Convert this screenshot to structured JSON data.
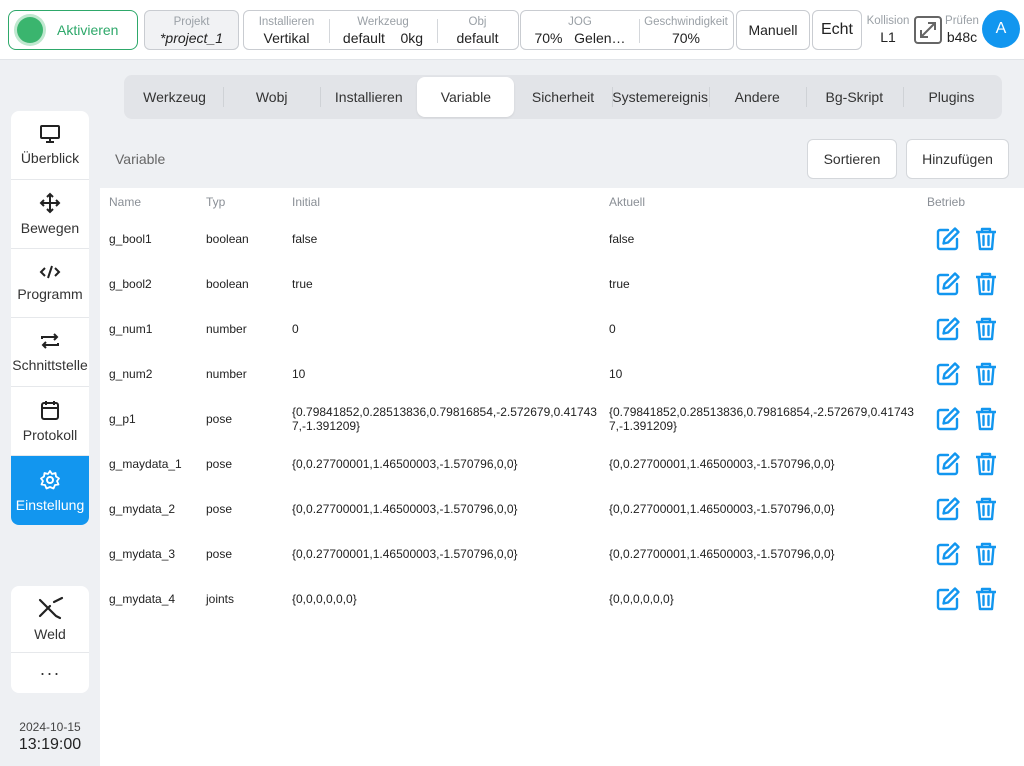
{
  "topbar": {
    "activate_label": "Aktivieren",
    "project": {
      "label": "Projekt",
      "value": "*project_1"
    },
    "install_group": [
      {
        "label": "Installieren",
        "value": "Vertikal"
      },
      {
        "label": "Werkzeug",
        "value": "default    0kg"
      },
      {
        "label": "Obj",
        "value": "default"
      }
    ],
    "jog_group": [
      {
        "label": "JOG",
        "value": "70%   Gelen…"
      },
      {
        "label": "Geschwindigkeit",
        "value": "70%"
      }
    ],
    "mode_label": "Manuell",
    "real_label": "Echt",
    "collision": {
      "label": "Kollision",
      "value": "L1"
    },
    "check": {
      "label": "Prüfen",
      "value": "b48c"
    },
    "avatar_letter": "A",
    "icons": {
      "expand": "expand-icon"
    }
  },
  "sidebar": {
    "items": [
      {
        "label": "Überblick",
        "icon": "monitor-icon"
      },
      {
        "label": "Bewegen",
        "icon": "move-icon"
      },
      {
        "label": "Programm",
        "icon": "code-icon"
      },
      {
        "label": "Schnittstelle",
        "icon": "swap-icon"
      },
      {
        "label": "Protokoll",
        "icon": "calendar-icon"
      },
      {
        "label": "Einstellung",
        "icon": "gear-icon",
        "active": true
      }
    ],
    "extra": [
      {
        "label": "Weld",
        "icon": "weld-icon"
      },
      {
        "label": "···",
        "icon": "more-icon"
      }
    ],
    "date": "2024-10-15",
    "time": "13:19:00"
  },
  "tabs": [
    {
      "label": "Werkzeug"
    },
    {
      "label": "Wobj"
    },
    {
      "label": "Installieren"
    },
    {
      "label": "Variable",
      "active": true
    },
    {
      "label": "Sicherheit"
    },
    {
      "label": "Systemereignis"
    },
    {
      "label": "Andere"
    },
    {
      "label": "Bg-Skript"
    },
    {
      "label": "Plugins"
    }
  ],
  "variable_panel": {
    "title": "Variable",
    "sort_label": "Sortieren",
    "add_label": "Hinzufügen",
    "columns": {
      "name": "Name",
      "type": "Typ",
      "initial": "Initial",
      "current": "Aktuell",
      "ops": "Betrieb"
    },
    "rows": [
      {
        "name": "g_bool1",
        "type": "boolean",
        "initial": "false",
        "current": "false"
      },
      {
        "name": "g_bool2",
        "type": "boolean",
        "initial": "true",
        "current": "true"
      },
      {
        "name": "g_num1",
        "type": "number",
        "initial": "0",
        "current": "0"
      },
      {
        "name": "g_num2",
        "type": "number",
        "initial": "10",
        "current": "10"
      },
      {
        "name": "g_p1",
        "type": "pose",
        "initial": "{0.79841852,0.28513836,0.79816854,-2.572679,0.417437,-1.391209}",
        "current": "{0.79841852,0.28513836,0.79816854,-2.572679,0.417437,-1.391209}"
      },
      {
        "name": "g_maydata_1",
        "type": "pose",
        "initial": "{0,0.27700001,1.46500003,-1.570796,0,0}",
        "current": "{0,0.27700001,1.46500003,-1.570796,0,0}"
      },
      {
        "name": "g_mydata_2",
        "type": "pose",
        "initial": "{0,0.27700001,1.46500003,-1.570796,0,0}",
        "current": "{0,0.27700001,1.46500003,-1.570796,0,0}"
      },
      {
        "name": "g_mydata_3",
        "type": "pose",
        "initial": "{0,0.27700001,1.46500003,-1.570796,0,0}",
        "current": "{0,0.27700001,1.46500003,-1.570796,0,0}"
      },
      {
        "name": "g_mydata_4",
        "type": "joints",
        "initial": "{0,0,0,0,0,0}",
        "current": "{0,0,0,0,0,0}"
      }
    ]
  },
  "colors": {
    "accent": "#1296ef",
    "active_green": "#2ea86a",
    "background": "#eef0f3"
  }
}
